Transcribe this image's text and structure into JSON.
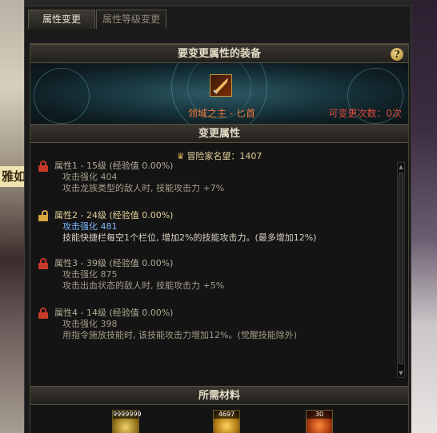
{
  "tabs": [
    {
      "label": "属性变更"
    },
    {
      "label": "属性等级变更"
    }
  ],
  "background": {
    "banner_text": "雅如"
  },
  "equipment_section": {
    "title": "要变更属性的装备",
    "item_name": "领域之主 - 匕首",
    "change_count": "可变更次数：0次",
    "help_label": "?"
  },
  "attributes_section": {
    "title": "变更属性",
    "reputation": "冒险家名望：1407",
    "attributes": [
      {
        "title": "属性1 - 15级 (经验值 0.00%)",
        "lines": [
          "攻击强化 404",
          "攻击龙族类型的敌人时, 技能攻击力 +7%"
        ],
        "locked": true
      },
      {
        "title": "属性2 - 24级 (经验值 0.00%)",
        "lines": [
          "攻击强化 481",
          "技能快捷栏每空1个栏位, 增加2%的技能攻击力。(最多增加12%)"
        ],
        "locked": false
      },
      {
        "title": "属性3 - 39级 (经验值 0.00%)",
        "lines": [
          "攻击强化 875",
          "攻击出血状态的敌人时, 技能攻击力 +5%"
        ],
        "locked": true
      },
      {
        "title": "属性4 - 14级 (经验值 0.00%)",
        "lines": [
          "攻击强化 398",
          "用指令施放技能时, 该技能攻击力增加12%。(觉醒技能除外)"
        ],
        "locked": true
      }
    ]
  },
  "materials_section": {
    "title": "所需材料",
    "items": [
      {
        "icon": "gold-coins-icon",
        "qty": "9999999"
      },
      {
        "icon": "gold-heart-crystal-icon",
        "qty": "4697"
      },
      {
        "icon": "fire-orb-icon",
        "qty": "30"
      }
    ]
  },
  "colors": {
    "orange_name": "#f07a3a",
    "red_count": "#e04a3a",
    "gold_text": "#e0cf9a",
    "blue_value": "#7ab6ff"
  }
}
